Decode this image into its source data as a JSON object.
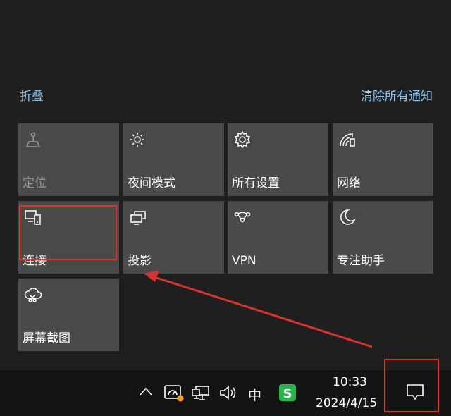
{
  "panel": {
    "collapse_label": "折叠",
    "clear_all_label": "清除所有通知"
  },
  "tiles": [
    {
      "label": "定位",
      "icon": "location-icon",
      "state": "disabled"
    },
    {
      "label": "夜间模式",
      "icon": "brightness-sun-icon",
      "state": "off"
    },
    {
      "label": "所有设置",
      "icon": "gear-icon",
      "state": "off"
    },
    {
      "label": "网络",
      "icon": "network-icon",
      "state": "off"
    },
    {
      "label": "连接",
      "icon": "connect-devices-icon",
      "state": "off"
    },
    {
      "label": "投影",
      "icon": "project-icon",
      "state": "off"
    },
    {
      "label": "VPN",
      "icon": "vpn-icon",
      "state": "off"
    },
    {
      "label": "专注助手",
      "icon": "moon-icon",
      "state": "off"
    },
    {
      "label": "屏幕截图",
      "icon": "screenshot-icon",
      "state": "off"
    }
  ],
  "taskbar": {
    "ime_label": "中",
    "time": "10:33",
    "date": "2024/4/15"
  },
  "colors": {
    "accent_link": "#8fc3ea",
    "tile_bg": "#4a4a4a",
    "annotation_red": "#d8332e",
    "notification_dot": "#f09a2e"
  }
}
